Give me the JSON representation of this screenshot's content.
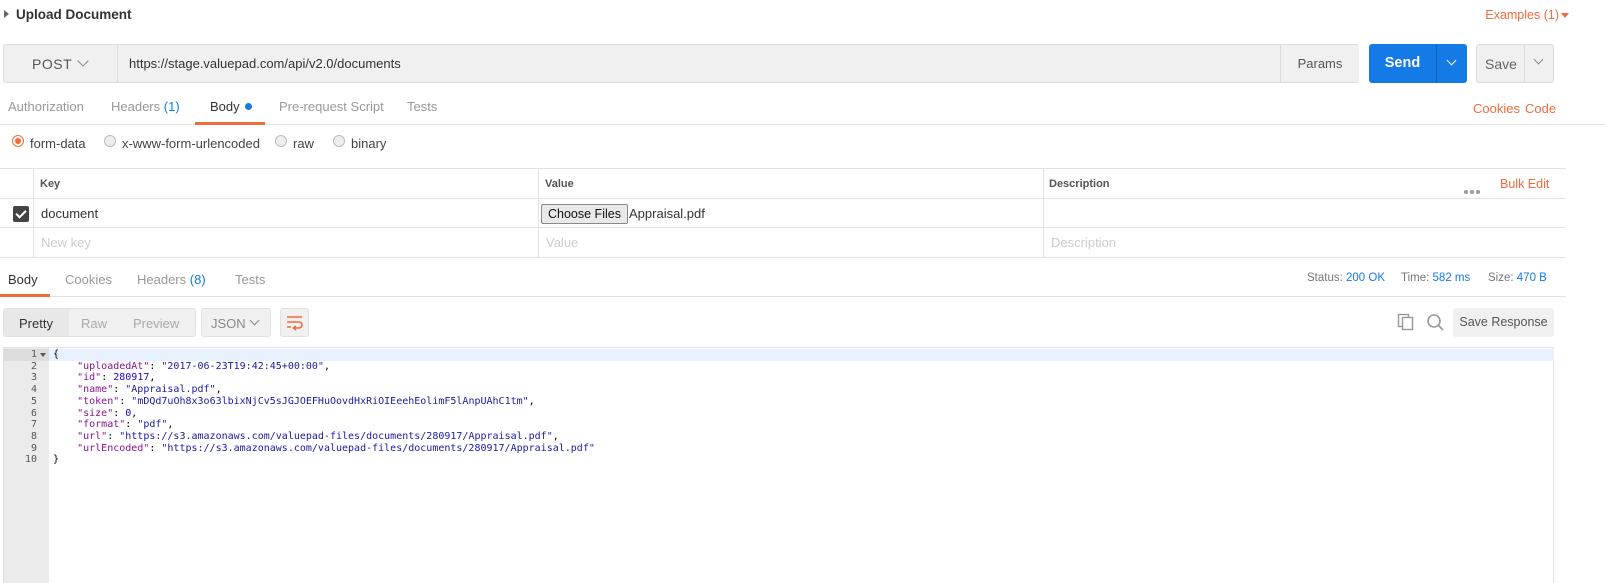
{
  "title": "Upload Document",
  "examples_label": "Examples (1)",
  "request": {
    "method": "POST",
    "url": "https://stage.valuepad.com/api/v2.0/documents",
    "params_label": "Params",
    "send_label": "Send",
    "save_label": "Save"
  },
  "req_tabs": {
    "authorization": "Authorization",
    "headers": "Headers",
    "headers_count": "(1)",
    "body": "Body",
    "prerequest": "Pre-request Script",
    "tests": "Tests",
    "cookies": "Cookies",
    "code": "Code"
  },
  "body_types": {
    "form_data": "form-data",
    "urlencoded": "x-www-form-urlencoded",
    "raw": "raw",
    "binary": "binary",
    "selected": "form-data"
  },
  "form_table": {
    "headers": {
      "key": "Key",
      "value": "Value",
      "description": "Description"
    },
    "bulk_edit": "Bulk Edit",
    "rows": [
      {
        "key": "document",
        "file_button": "Choose Files",
        "file_name": "Appraisal.pdf",
        "checked": true
      }
    ],
    "placeholders": {
      "key": "New key",
      "value": "Value",
      "description": "Description"
    }
  },
  "response": {
    "tabs": {
      "body": "Body",
      "cookies": "Cookies",
      "headers": "Headers",
      "headers_count": "(8)",
      "tests": "Tests"
    },
    "status_label": "Status:",
    "status_value": "200 OK",
    "time_label": "Time:",
    "time_value": "582 ms",
    "size_label": "Size:",
    "size_value": "470 B",
    "view_modes": {
      "pretty": "Pretty",
      "raw": "Raw",
      "preview": "Preview"
    },
    "format": "JSON",
    "save_response": "Save Response",
    "line_numbers": [
      "1",
      "2",
      "3",
      "4",
      "5",
      "6",
      "7",
      "8",
      "9",
      "10"
    ],
    "json": {
      "open": "{",
      "close": "}",
      "fields": [
        {
          "key": "\"uploadedAt\"",
          "value": "\"2017-06-23T19:42:45+00:00\"",
          "type": "string",
          "comma": ","
        },
        {
          "key": "\"id\"",
          "value": "280917",
          "type": "number",
          "comma": ","
        },
        {
          "key": "\"name\"",
          "value": "\"Appraisal.pdf\"",
          "type": "string",
          "comma": ","
        },
        {
          "key": "\"token\"",
          "value": "\"mDQd7uOh8x3o63lbixNjCv5sJGJOEFHuOovdHxRiOIEeehEolimF5lAnpUAhC1tm\"",
          "type": "string",
          "comma": ","
        },
        {
          "key": "\"size\"",
          "value": "0",
          "type": "number",
          "comma": ","
        },
        {
          "key": "\"format\"",
          "value": "\"pdf\"",
          "type": "string",
          "comma": ","
        },
        {
          "key": "\"url\"",
          "value": "\"https://s3.amazonaws.com/valuepad-files/documents/280917/Appraisal.pdf\"",
          "type": "string",
          "comma": ","
        },
        {
          "key": "\"urlEncoded\"",
          "value": "\"https://s3.amazonaws.com/valuepad-files/documents/280917/Appraisal.pdf\"",
          "type": "string",
          "comma": ""
        }
      ]
    }
  },
  "colors": {
    "accent": "#f26b3a",
    "primary": "#147ae6"
  }
}
